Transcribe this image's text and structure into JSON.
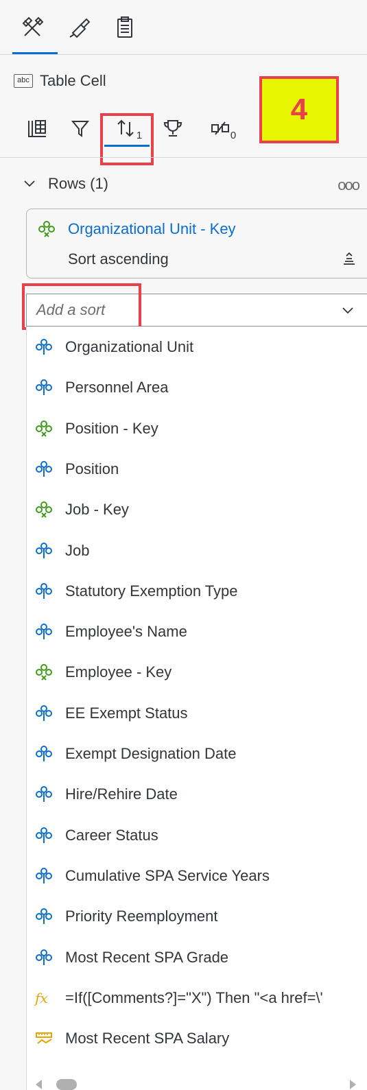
{
  "top_tabs": [
    {
      "icon": "tools-icon",
      "active": true
    },
    {
      "icon": "paint-brush-icon",
      "active": false
    },
    {
      "icon": "clipboard-icon",
      "active": false
    }
  ],
  "object": {
    "type_icon_text": "abc",
    "title": "Table Cell"
  },
  "sub_tabs": [
    {
      "icon": "table-dimensions-icon",
      "subscript": ""
    },
    {
      "icon": "filter-icon",
      "subscript": ""
    },
    {
      "icon": "sort-icon",
      "subscript": "1",
      "active": true
    },
    {
      "icon": "trophy-icon",
      "subscript": ""
    },
    {
      "icon": "conditional-format-icon",
      "subscript": "0"
    }
  ],
  "callout": {
    "text": "4"
  },
  "rows_section": {
    "label": "Rows (1)",
    "more_icon": "ooo"
  },
  "sort_card": {
    "title": "Organizational Unit - Key",
    "subtitle": "Sort ascending"
  },
  "add_sort": {
    "placeholder": "Add a sort"
  },
  "dropdown_items": [
    {
      "label": "Organizational Unit",
      "icon": "dimension-icon",
      "color": "#0a6ed1"
    },
    {
      "label": "Personnel Area",
      "icon": "dimension-icon",
      "color": "#0a6ed1"
    },
    {
      "label": "Position - Key",
      "icon": "key-dimension-icon",
      "color": "#3d9c1a"
    },
    {
      "label": "Position",
      "icon": "dimension-icon",
      "color": "#0a6ed1"
    },
    {
      "label": "Job - Key",
      "icon": "key-dimension-icon",
      "color": "#3d9c1a"
    },
    {
      "label": "Job",
      "icon": "dimension-icon",
      "color": "#0a6ed1"
    },
    {
      "label": "Statutory Exemption Type",
      "icon": "dimension-icon",
      "color": "#0a6ed1"
    },
    {
      "label": "Employee's Name",
      "icon": "dimension-icon",
      "color": "#0a6ed1"
    },
    {
      "label": "Employee - Key",
      "icon": "key-dimension-icon",
      "color": "#3d9c1a"
    },
    {
      "label": "EE Exempt Status",
      "icon": "dimension-icon",
      "color": "#0a6ed1"
    },
    {
      "label": "Exempt Designation Date",
      "icon": "dimension-icon",
      "color": "#0a6ed1"
    },
    {
      "label": "Hire/Rehire Date",
      "icon": "dimension-icon",
      "color": "#0a6ed1"
    },
    {
      "label": "Career Status",
      "icon": "dimension-icon",
      "color": "#0a6ed1"
    },
    {
      "label": "Cumulative SPA Service Years",
      "icon": "dimension-icon",
      "color": "#0a6ed1"
    },
    {
      "label": "Priority Reemployment",
      "icon": "dimension-icon",
      "color": "#0a6ed1"
    },
    {
      "label": "Most Recent SPA Grade",
      "icon": "dimension-icon",
      "color": "#0a6ed1"
    },
    {
      "label": "=If([Comments?]=\"X\") Then \"<a href=\\'",
      "icon": "formula-icon",
      "color": "#e9a400"
    },
    {
      "label": "Most Recent SPA Salary",
      "icon": "measure-icon",
      "color": "#e9a400"
    }
  ],
  "colors": {
    "accent": "#0a6ed1",
    "highlight_border": "#e8414b",
    "callout_bg": "#e8f500",
    "key_dimension": "#3d9c1a"
  }
}
